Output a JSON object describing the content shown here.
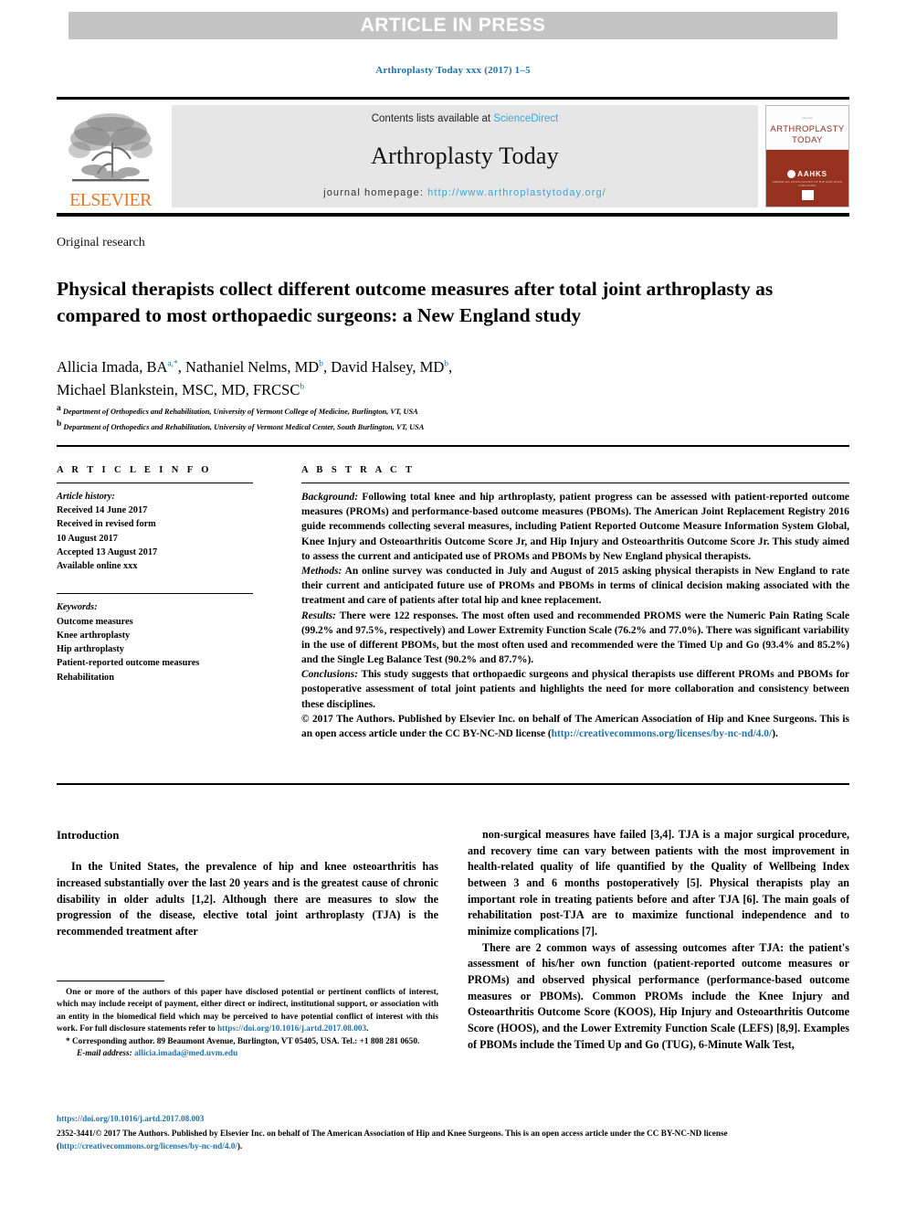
{
  "banner": {
    "text": "ARTICLE IN PRESS"
  },
  "running_head": "Arthroplasty Today xxx (2017) 1–5",
  "masthead": {
    "elsevier_word": "ELSEVIER",
    "contents_prefix": "Contents lists available at ",
    "contents_link": "ScienceDirect",
    "journal_name": "Arthroplasty Today",
    "homepage_prefix": "journal homepage: ",
    "homepage_url": "http://www.arthroplastytoday.org/",
    "cover": {
      "micro_text": "xxx xxx",
      "title_line1": "ARTHROPLASTY",
      "title_line2": "TODAY",
      "society": "AAHKS",
      "society_sub": "AMERICAN ASSOCIATION OF HIP AND KNEE SURGEONS"
    }
  },
  "article": {
    "kind": "Original research",
    "title": "Physical therapists collect different outcome measures after total joint arthroplasty as compared to most orthopaedic surgeons: a New England study",
    "authors_line1_pre": "Allicia Imada, BA",
    "authors_line1_sup1": "a,",
    "authors_line1_sup_star": "*",
    "authors_line1_mid": ", Nathaniel Nelms, MD",
    "authors_line1_sup2": "b",
    "authors_line1_mid2": ", David Halsey, MD",
    "authors_line1_sup3": "b",
    "authors_line1_end": ",",
    "authors_line2": "Michael Blankstein, MSC, MD, FRCSC",
    "authors_line2_sup": "b",
    "affiliation_a_sup": "a",
    "affiliation_a": "Department of Orthopedics and Rehabilitation, University of Vermont College of Medicine, Burlington, VT, USA",
    "affiliation_b_sup": "b",
    "affiliation_b": "Department of Orthopedics and Rehabilitation, University of Vermont Medical Center, South Burlington, VT, USA"
  },
  "article_info": {
    "heading": "A R T I C L E  I N F O",
    "history_label": "Article history:",
    "history": [
      "Received 14 June 2017",
      "Received in revised form",
      "10 August 2017",
      "Accepted 13 August 2017",
      "Available online xxx"
    ],
    "keywords_label": "Keywords:",
    "keywords": [
      "Outcome measures",
      "Knee arthroplasty",
      "Hip arthroplasty",
      "Patient-reported outcome measures",
      "Rehabilitation"
    ]
  },
  "abstract": {
    "heading": "A B S T R A C T",
    "background_label": "Background:",
    "background": "Following total knee and hip arthroplasty, patient progress can be assessed with patient-reported outcome measures (PROMs) and performance-based outcome measures (PBOMs). The American Joint Replacement Registry 2016 guide recommends collecting several measures, including Patient Reported Outcome Measure Information System Global, Knee Injury and Osteoarthritis Outcome Score Jr, and Hip Injury and Osteoarthritis Outcome Score Jr. This study aimed to assess the current and anticipated use of PROMs and PBOMs by New England physical therapists.",
    "methods_label": "Methods:",
    "methods": "An online survey was conducted in July and August of 2015 asking physical therapists in New England to rate their current and anticipated future use of PROMs and PBOMs in terms of clinical decision making associated with the treatment and care of patients after total hip and knee replacement.",
    "results_label": "Results:",
    "results": "There were 122 responses. The most often used and recommended PROMS were the Numeric Pain Rating Scale (99.2% and 97.5%, respectively) and Lower Extremity Function Scale (76.2% and 77.0%). There was significant variability in the use of different PBOMs, but the most often used and recommended were the Timed Up and Go (93.4% and 85.2%) and the Single Leg Balance Test (90.2% and 87.7%).",
    "conclusions_label": "Conclusions:",
    "conclusions": "This study suggests that orthopaedic surgeons and physical therapists use different PROMs and PBOMs for postoperative assessment of total joint patients and highlights the need for more collaboration and consistency between these disciplines.",
    "copyright": "© 2017 The Authors. Published by Elsevier Inc. on behalf of The American Association of Hip and Knee Surgeons. This is an open access article under the CC BY-NC-ND license (",
    "copyright_link": "http://creativecommons.org/licenses/by-nc-nd/4.0/",
    "copyright_tail": ")."
  },
  "body": {
    "intro_heading": "Introduction",
    "left_para1": "In the United States, the prevalence of hip and knee osteoarthritis has increased substantially over the last 20 years and is the greatest cause of chronic disability in older adults [1,2]. Although there are measures to slow the progression of the disease, elective total joint arthroplasty (TJA) is the recommended treatment after",
    "left_ref1": "[1,2]",
    "right_para1": "non-surgical measures have failed [3,4]. TJA is a major surgical procedure, and recovery time can vary between patients with the most improvement in health-related quality of life quantified by the Quality of Wellbeing Index between 3 and 6 months postoperatively [5]. Physical therapists play an important role in treating patients before and after TJA [6]. The main goals of rehabilitation post-TJA are to maximize functional independence and to minimize complications [7].",
    "right_para2": "There are 2 common ways of assessing outcomes after TJA: the patient's assessment of his/her own function (patient-reported outcome measures or PROMs) and observed physical performance (performance-based outcome measures or PBOMs). Common PROMs include the Knee Injury and Osteoarthritis Outcome Score (KOOS), Hip Injury and Osteoarthritis Outcome Score (HOOS), and the Lower Extremity Function Scale (LEFS) [8,9]. Examples of PBOMs include the Timed Up and Go (TUG), 6-Minute Walk Test,"
  },
  "footnote": {
    "conflict_text": "One or more of the authors of this paper have disclosed potential or pertinent conflicts of interest, which may include receipt of payment, either direct or indirect, institutional support, or association with an entity in the biomedical field which may be perceived to have potential conflict of interest with this work. For full disclosure statements refer to ",
    "conflict_link": "https://doi.org/10.1016/j.artd.2017.08.003",
    "conflict_tail": ".",
    "corresponding": "* Corresponding author. 89 Beaumont Avenue, Burlington, VT 05405, USA. Tel.: +1 808 281 0650.",
    "email_label": "E-mail address:",
    "email": "allicia.imada@med.uvm.edu"
  },
  "publisher_footer": {
    "doi": "https://doi.org/10.1016/j.artd.2017.08.003",
    "issn_line": "2352-3441/© 2017 The Authors. Published by Elsevier Inc. on behalf of The American Association of Hip and Knee Surgeons. This is an open access article under the CC BY-NC-ND license (",
    "license_link": "http://creativecommons.org/licenses/by-nc-nd/4.0/",
    "issn_tail": ")."
  },
  "colors": {
    "link": "#1f72a8",
    "banner_bg": "#c4c4c4",
    "elsevier_orange": "#e87722",
    "cover_red": "#97311f",
    "panel_grey": "#e6e6e6"
  }
}
